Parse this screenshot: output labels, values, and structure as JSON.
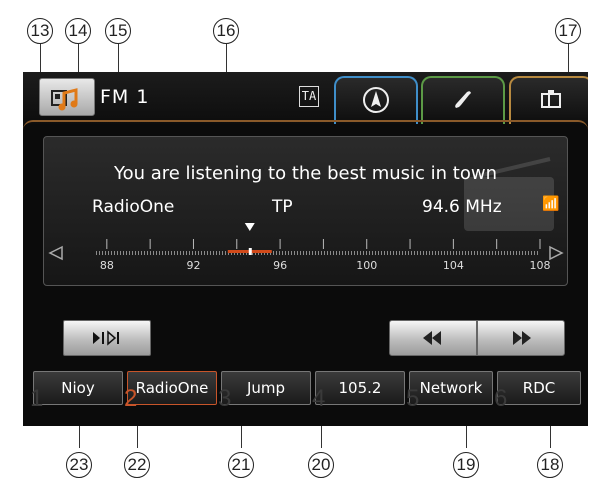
{
  "header": {
    "band": "FM 1",
    "ta_label": "TA"
  },
  "info": {
    "radio_text": "You are listening to the best music in town",
    "station": "RadioOne",
    "tp": "TP",
    "frequency": "94.6 MHz"
  },
  "tuner": {
    "scale_labels": [
      "88",
      "92",
      "96",
      "100",
      "104",
      "108"
    ],
    "current_frequency_mhz": 94.6,
    "range_mhz": [
      87.5,
      108
    ]
  },
  "presets": [
    {
      "num": "1",
      "label": "Nioy"
    },
    {
      "num": "2",
      "label": "RadioOne"
    },
    {
      "num": "3",
      "label": "Jump"
    },
    {
      "num": "4",
      "label": "105.2"
    },
    {
      "num": "5",
      "label": "Network"
    },
    {
      "num": "6",
      "label": "RDC"
    }
  ],
  "callouts": [
    "13",
    "14",
    "15",
    "16",
    "17",
    "18",
    "19",
    "20",
    "21",
    "22",
    "23"
  ],
  "icons": {
    "source": "music-note-radio-icon",
    "ta": "traffic-announcement-icon",
    "nav": "navigation-compass-icon",
    "phone": "phone-handset-icon",
    "media": "media-device-icon",
    "scan": "scan-icon",
    "seek_back": "seek-backward-icon",
    "seek_forward": "seek-forward-icon"
  },
  "colors": {
    "nav_tab": "#3f8ec9",
    "phone_tab": "#5c9a46",
    "media_tab": "#b88a40",
    "active_preset": "#c8552a",
    "tuner_marker": "#d24a1a"
  }
}
